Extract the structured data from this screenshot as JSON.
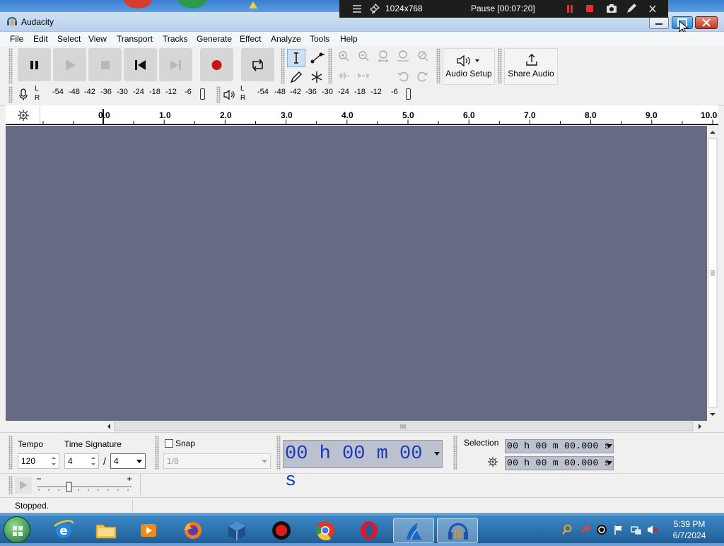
{
  "window": {
    "title": "Audacity"
  },
  "recorder": {
    "resolution": "1024x768",
    "pause_label": "Pause [00:07:20]"
  },
  "menu": [
    "File",
    "Edit",
    "Select",
    "View",
    "Transport",
    "Tracks",
    "Generate",
    "Effect",
    "Analyze",
    "Tools",
    "Help"
  ],
  "toolbar": {
    "audio_setup_label": "Audio Setup",
    "share_audio_label": "Share Audio"
  },
  "meters": {
    "left_label": "L",
    "right_label": "R",
    "ticks": [
      "-54",
      "-48",
      "-42",
      "-36",
      "-30",
      "-24",
      "-18",
      "-12",
      "-6"
    ]
  },
  "ruler": {
    "labels": [
      "0.0",
      "1.0",
      "2.0",
      "3.0",
      "4.0",
      "5.0",
      "6.0",
      "7.0",
      "8.0",
      "9.0",
      "10.0"
    ]
  },
  "bottom": {
    "tempo_label": "Tempo",
    "tempo_value": "120",
    "time_signature_label": "Time Signature",
    "time_sig_numerator": "4",
    "time_sig_slash": "/",
    "time_sig_denominator": "4",
    "snap_label": "Snap",
    "snap_value": "1/8",
    "time_display": "00 h 00 m 00 s",
    "selection_label": "Selection",
    "selection_start": "00 h 00 m 00.000 s",
    "selection_end": "00 h 00 m 00.000 s"
  },
  "status": {
    "text": "Stopped."
  },
  "clock": {
    "time": "5:39 PM",
    "date": "6/7/2024"
  },
  "colors": {
    "track_background": "#666b84",
    "time_digits": "#1d3ab4",
    "record_red": "#c81414"
  }
}
